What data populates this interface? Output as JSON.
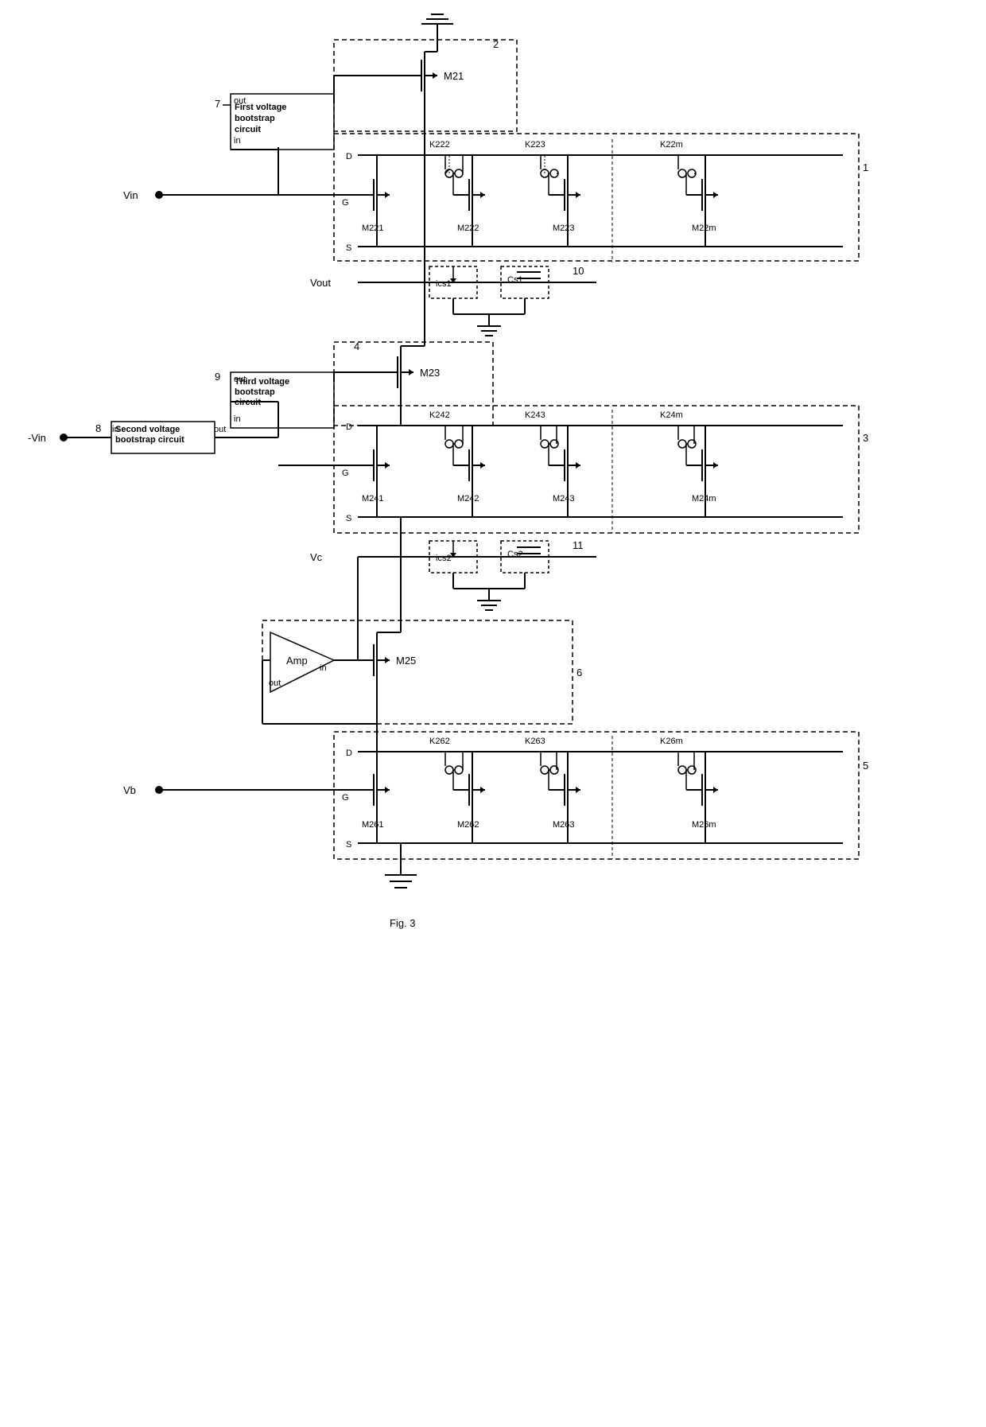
{
  "diagram": {
    "title": "Fig. 3",
    "components": {
      "M21": "M21",
      "M23": "M23",
      "M25": "M25",
      "M221": "M221",
      "M222": "M222",
      "M223": "M223",
      "M22m": "M22m",
      "M241": "M241",
      "M242": "M242",
      "M243": "M243",
      "M24m": "M24m",
      "M261": "M261",
      "M262": "M262",
      "M263": "M263",
      "M26m": "M26m",
      "K222": "K222",
      "K223": "K223",
      "K22m": "K22m",
      "K242": "K242",
      "K243": "K243",
      "K24m": "K24m",
      "K262": "K262",
      "K263": "K263",
      "K26m": "K26m"
    },
    "labels": {
      "Vin": "Vin",
      "neg_Vin": "-Vin",
      "Vout": "Vout",
      "Vc": "Vc",
      "Vb": "Vb",
      "ics1": "ics1",
      "ics2": "ics2",
      "Cs1": "Cs1",
      "Cs2": "Cs2",
      "D": "D",
      "G": "G",
      "S": "S",
      "in": "in",
      "out": "out",
      "fig": "Fig. 3"
    },
    "boxes": {
      "box1": "First voltage bootstrap circuit",
      "box2": "Second voltage bootstrap circuit",
      "box3": "Third voltage bootstrap circuit",
      "box_amp": "Amp"
    },
    "numbers": {
      "n1": "1",
      "n2": "2",
      "n3": "3",
      "n4": "4",
      "n5": "5",
      "n6": "6",
      "n7": "7",
      "n8": "8",
      "n9": "9",
      "n10": "10",
      "n11": "11"
    }
  }
}
